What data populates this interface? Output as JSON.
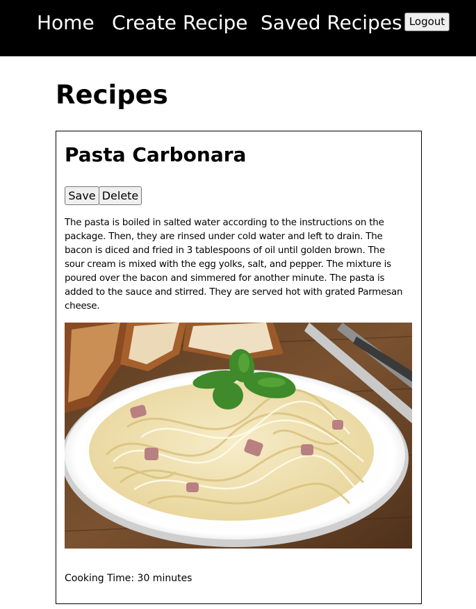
{
  "nav": {
    "home": "Home",
    "create_recipe": "Create Recipe",
    "saved_recipes": "Saved Recipes",
    "logout": "Logout"
  },
  "page": {
    "title": "Recipes"
  },
  "recipes": [
    {
      "name": "Pasta Carbonara",
      "save_label": "Save",
      "delete_label": "Delete",
      "instructions": "The pasta is boiled in salted water according to the instructions on the package. Then, they are rinsed under cold water and left to drain. The bacon is diced and fried in 3 tablespoons of oil until golden brown. The sour cream is mixed with the egg yolks, salt, and pepper. The mixture is poured over the bacon and simmered for another minute. The pasta is added to the sauce and stirred. They are served hot with grated Parmesan cheese.",
      "image_subject": "plate-of-creamy-fettuccine-with-bacon-and-basil",
      "cooking_time": "Cooking Time: 30 minutes"
    }
  ],
  "colors": {
    "navbar_bg": "#000000",
    "nav_text": "#ffffff",
    "page_bg": "#ffffff",
    "button_bg": "#efefef",
    "button_border": "#767676",
    "card_border": "#000000"
  }
}
